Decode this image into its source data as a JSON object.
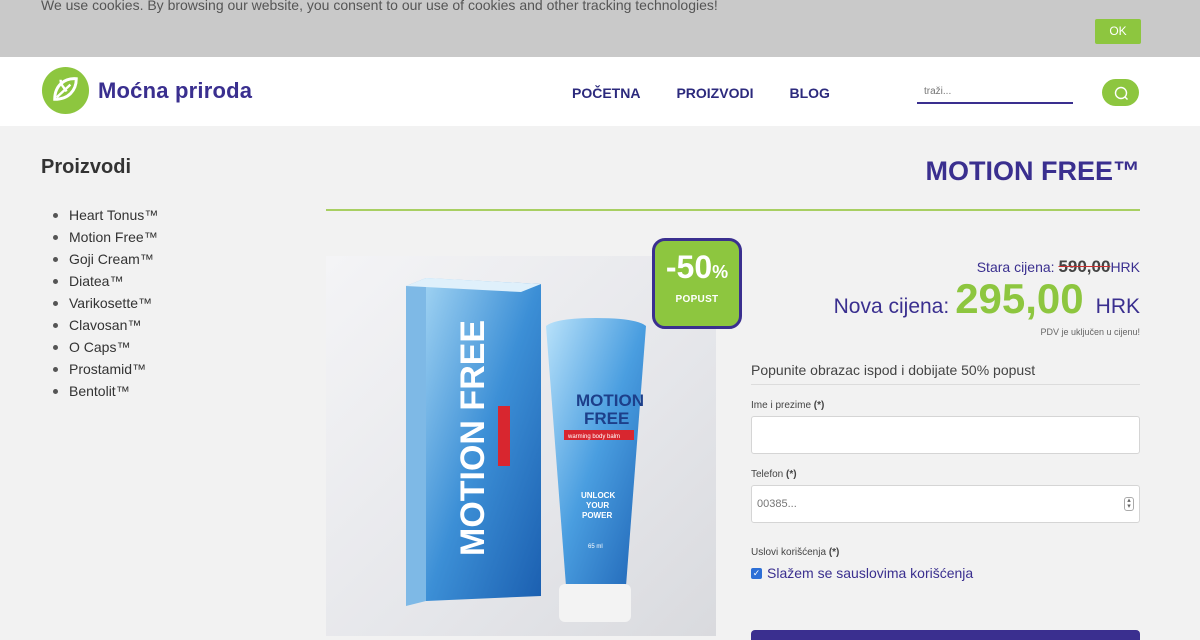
{
  "cookie": {
    "text": "We use cookies. By browsing our website, you consent to our use of cookies and other tracking technologies!",
    "ok_label": "OK"
  },
  "header": {
    "logo_text": "Moćna priroda",
    "nav": [
      "POČETNA",
      "PROIZVODI",
      "BLOG"
    ],
    "search_placeholder": "traži..."
  },
  "sidebar": {
    "title": "Proizvodi",
    "items": [
      "Heart Tonus™",
      "Motion Free™",
      "Goji Cream™",
      "Diatea™",
      "Varikosette™",
      "Clavosan™",
      "O Caps™",
      "Prostamid™",
      "Bentolit™"
    ]
  },
  "product": {
    "title": "MOTION FREE™",
    "discount_pct": "-50",
    "discount_pct_sign": "%",
    "discount_label": "POPUST",
    "old_price_label": "Stara cijena:",
    "old_price_value": "590,00",
    "old_price_currency": "HRK",
    "new_price_label": "Nova cijena:",
    "new_price_value": "295,00",
    "new_price_currency": "HRK",
    "vat_note": "PDV je uključen u cijenu!",
    "image": {
      "box_brand": "MOTION FREE",
      "tube_brand_1": "MOTION",
      "tube_brand_2": "FREE",
      "tube_tagline": "warming body balm",
      "tube_slogan_1": "UNLOCK",
      "tube_slogan_2": "YOUR",
      "tube_slogan_3": "POWER",
      "tube_volume": "65 ml"
    }
  },
  "form": {
    "heading": "Popunite obrazac ispod i dobijate 50% popust",
    "name_label": "Ime i prezime",
    "phone_label": "Telefon",
    "phone_placeholder": "00385...",
    "terms_label": "Uslovi korišćenja",
    "required_mark": "(*)",
    "agree_prefix": "Slažem se sa ",
    "agree_link": "uslovima korišćenja"
  },
  "colors": {
    "brand_purple": "#3a2f8f",
    "brand_green": "#8dc63f"
  }
}
